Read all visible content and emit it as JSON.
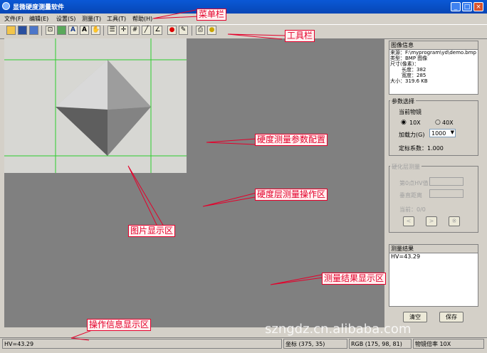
{
  "window": {
    "title": "显微硬度测量软件",
    "min": "_",
    "max": "□",
    "close": "×"
  },
  "menu": [
    "文件(F)",
    "编辑(E)",
    "设置(S)",
    "测量(T)",
    "工具(T)",
    "帮助(H)"
  ],
  "toolbar_icons": [
    "folder-icon",
    "save-icon",
    "save-as-icon",
    "zoom-icon",
    "image-icon",
    "text-icon",
    "font-icon",
    "hand-icon",
    "bars-icon",
    "crosshair-icon",
    "grid-icon",
    "line-icon",
    "angle-icon",
    "stop-icon",
    "paint-icon",
    "print-icon",
    "bulb-icon"
  ],
  "image_info": {
    "title": "图像信息",
    "source": "来源：F:\\myprogram\\yd\\demo.bmp",
    "type": "类型：BMP 图像",
    "size_label": "尺寸(像素)：",
    "length": "长度：382",
    "width": "宽度：285",
    "filesize": "大小：319.6 KB"
  },
  "params": {
    "title": "参数选择",
    "objective_label": "当前物镜",
    "opt1": "10X",
    "opt2": "40X",
    "force_label": "加载力(G)",
    "force_value": "1000",
    "calib": "定标系数：1.000"
  },
  "hardened": {
    "title": "硬化层测量",
    "row1": "第0点HV值",
    "row2": "垂直距离",
    "current": "当前：0/0",
    "btn_prev": "<",
    "btn_next": ">",
    "btn_del": "※"
  },
  "results": {
    "title": "测量结果",
    "value": "HV=43.29"
  },
  "buttons": {
    "clear": "清空",
    "save": "保存"
  },
  "status": {
    "msg": "HV=43.29",
    "coord": "坐标 (375, 35)",
    "rgb": "RGB (175, 98, 81)",
    "zoom": "物镜倍率 10X"
  },
  "annotations": {
    "menubar": "菜单栏",
    "toolbar": "工具栏",
    "params": "硬度测量参数配置",
    "hardened": "硬度层测量操作区",
    "image": "图片显示区",
    "results": "测量结果显示区",
    "info": "操作信息显示区"
  },
  "watermark": "szngdz.cn.alibaba.com"
}
